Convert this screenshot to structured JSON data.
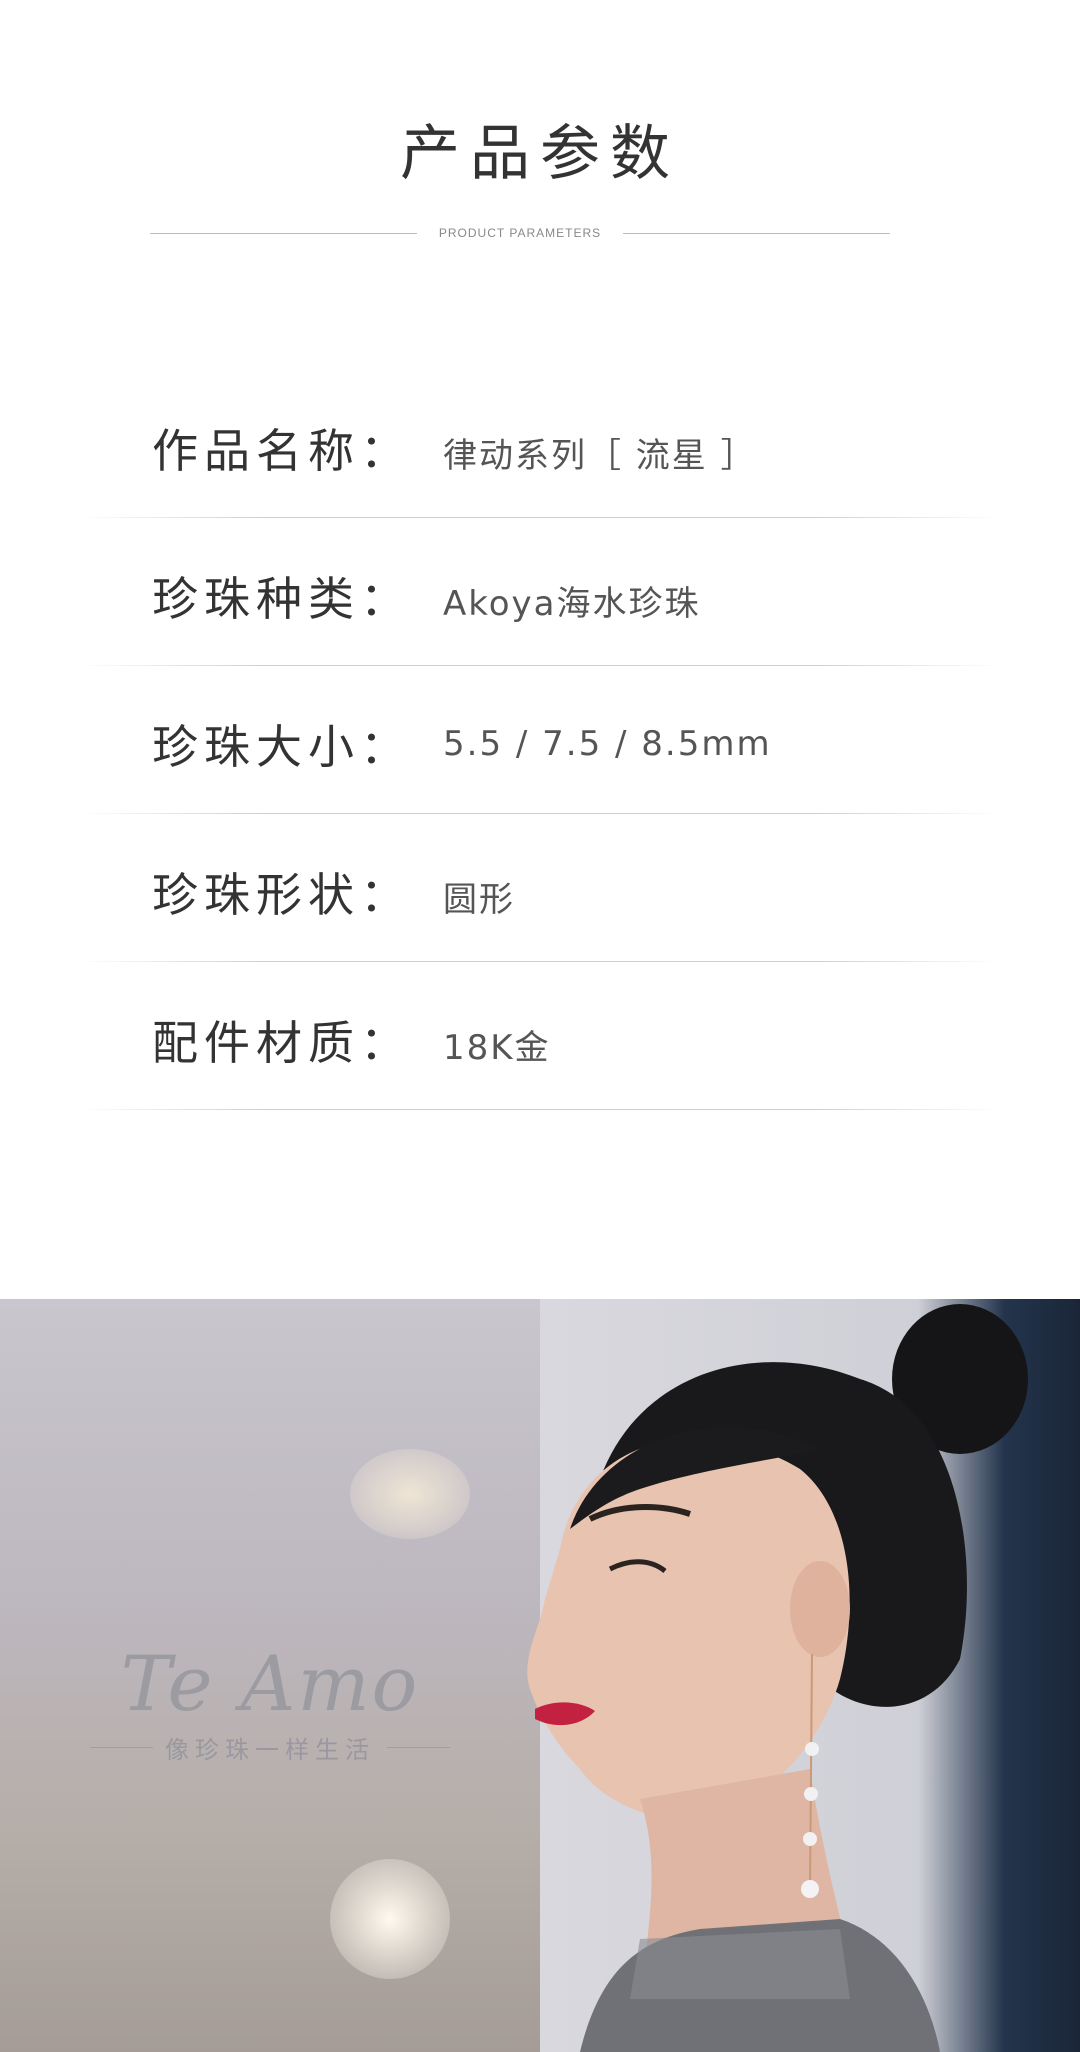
{
  "header": {
    "title": "产品参数",
    "subtitle": "PRODUCT PARAMETERS"
  },
  "params": [
    {
      "label": "作品名称：",
      "value": "律动系列［ 流星 ］"
    },
    {
      "label": "珍珠种类：",
      "value": "Akoya海水珍珠"
    },
    {
      "label": "珍珠大小：",
      "value": "5.5 / 7.5 / 8.5mm"
    },
    {
      "label": "珍珠形状：",
      "value": "圆形"
    },
    {
      "label": "配件材质：",
      "value": "18K金"
    }
  ],
  "photo": {
    "logo_script": "Te Amo",
    "logo_tagline": "像珍珠一样生活"
  }
}
